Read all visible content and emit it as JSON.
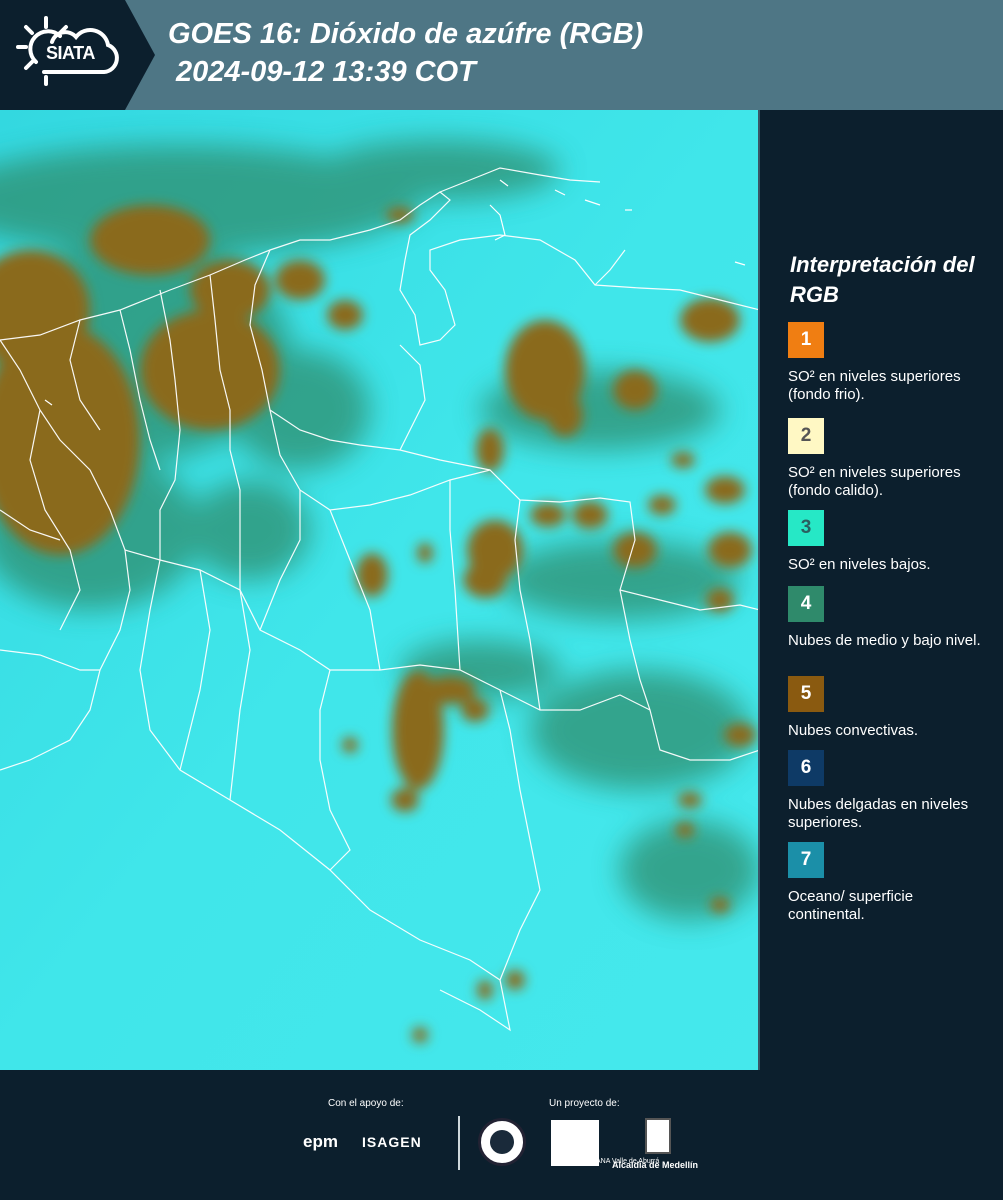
{
  "header": {
    "logo_text": "SIATA",
    "title": "GOES 16: Dióxido de azúfre (RGB)",
    "subtitle": "2024-09-12 13:39 COT"
  },
  "map": {
    "background_color": "#3fe3e6",
    "cloud_color": "#8a6a1e",
    "thin_cloud_color": "#3a8a6a",
    "border_color": "#ffffff"
  },
  "legend": {
    "title": "Interpretación del RGB",
    "items": [
      {
        "number": "1",
        "color": "#f07e12",
        "text": "SO² en niveles superiores (fondo frio)."
      },
      {
        "number": "2",
        "color": "#fff8c4",
        "text": "SO² en niveles superiores (fondo calido)."
      },
      {
        "number": "3",
        "color": "#26e8c6",
        "text": "SO² en niveles bajos."
      },
      {
        "number": "4",
        "color": "#2f8a6b",
        "text": "Nubes de medio y bajo nivel."
      },
      {
        "number": "5",
        "color": "#8a5a10",
        "text": "Nubes convectivas."
      },
      {
        "number": "6",
        "color": "#0e3a66",
        "text": "Nubes delgadas en niveles superiores."
      },
      {
        "number": "7",
        "color": "#1b8fa8",
        "text": "Oceano/ superficie continental."
      }
    ]
  },
  "footer": {
    "support_label": "Con el apoyo de:",
    "project_label": "Un proyecto de:",
    "epm": "epm",
    "isagen": "ISAGEN",
    "area_sub": "METROPOLITANA Valle de Aburrá",
    "alcaldia": "Alcaldía de Medellín"
  }
}
